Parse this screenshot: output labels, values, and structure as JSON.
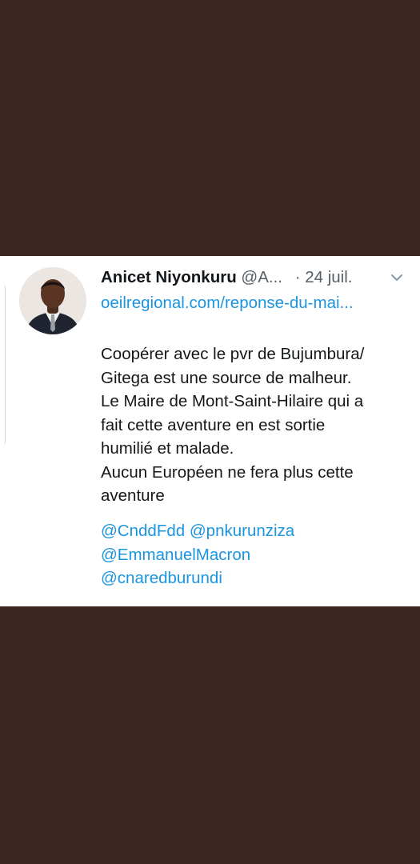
{
  "tweet": {
    "author_name": "Anicet Niyonkuru",
    "handle": "@A...",
    "date": "· 24 juil.",
    "link": "oeilregional.com/reponse-du-mai...",
    "body_lines": [
      "Coopérer avec le pvr de Bujumbura/",
      "Gitega est une source de malheur.",
      "Le Maire de Mont-Saint-Hilaire qui a",
      "fait cette aventure en est sortie",
      "humilié et malade.",
      "Aucun Européen ne fera plus cette",
      "aventure"
    ],
    "mentions": [
      "@CnddFdd",
      "@pnkurunziza",
      "@EmmanuelMacron",
      "@cnaredburundi"
    ],
    "icons": {
      "menu": "chevron-down-icon",
      "avatar": "profile-photo"
    }
  },
  "colors": {
    "background": "#3d2522",
    "card": "#ffffff",
    "link": "#1b95e0",
    "text": "#14171a",
    "muted": "#555f68"
  }
}
